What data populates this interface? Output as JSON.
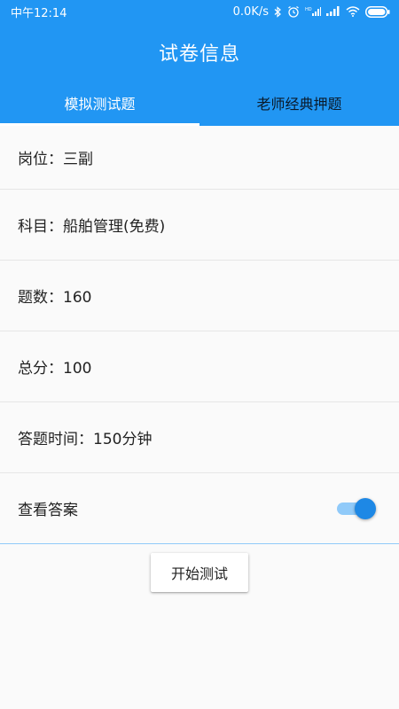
{
  "status_bar": {
    "time": "中午12:14",
    "network_speed": "0.0K/s",
    "icons": [
      "bluetooth-icon",
      "alarm-icon",
      "hd-signal-icon",
      "signal-icon",
      "wifi-icon",
      "battery-icon"
    ]
  },
  "header": {
    "title": "试卷信息",
    "tabs": [
      {
        "label": "模拟测试题",
        "active": true
      },
      {
        "label": "老师经典押题",
        "active": false
      }
    ]
  },
  "info": {
    "position": "岗位：三副",
    "subject": "科目：船舶管理(免费)",
    "question_count": "题数：160",
    "total_score": "总分：100",
    "answer_time": "答题时间：150分钟",
    "view_answer_label": "查看答案",
    "view_answer_enabled": true
  },
  "actions": {
    "start_label": "开始测试"
  },
  "colors": {
    "primary": "#2196f3",
    "switch_thumb": "#1e88e5",
    "switch_track": "#90caf9"
  }
}
